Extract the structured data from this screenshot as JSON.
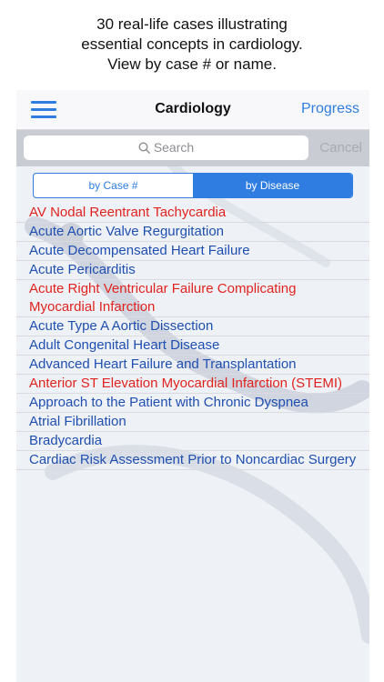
{
  "caption": {
    "line1": "30 real-life cases illustrating",
    "line2": "essential concepts in cardiology.",
    "line3": "View by case # or name."
  },
  "navbar": {
    "title": "Cardiology",
    "progress_label": "Progress"
  },
  "search": {
    "placeholder": "Search",
    "cancel_label": "Cancel"
  },
  "segments": {
    "by_case": "by Case #",
    "by_disease": "by Disease",
    "selected": "by Disease"
  },
  "colors": {
    "accent": "#2f7de1",
    "highlight_red": "#e0231f",
    "item_blue": "#1f4fb0"
  },
  "cases": [
    {
      "title": "AV Nodal Reentrant Tachycardia",
      "color": "red"
    },
    {
      "title": "Acute Aortic Valve Regurgitation",
      "color": "blue"
    },
    {
      "title": "Acute Decompensated Heart Failure",
      "color": "blue"
    },
    {
      "title": "Acute Pericarditis",
      "color": "blue"
    },
    {
      "title": "Acute Right Ventricular Failure Complicating Myocardial Infarction",
      "color": "red"
    },
    {
      "title": "Acute Type A Aortic Dissection",
      "color": "blue"
    },
    {
      "title": "Adult Congenital Heart Disease",
      "color": "blue"
    },
    {
      "title": "Advanced Heart Failure and Transplantation",
      "color": "blue"
    },
    {
      "title": "Anterior ST Elevation Myocardial Infarction (STEMI)",
      "color": "red"
    },
    {
      "title": "Approach to the Patient with Chronic Dyspnea",
      "color": "blue"
    },
    {
      "title": "Atrial Fibrillation",
      "color": "blue"
    },
    {
      "title": "Bradycardia",
      "color": "blue"
    },
    {
      "title": "Cardiac Risk Assessment Prior to Noncardiac Surgery",
      "color": "blue"
    }
  ]
}
